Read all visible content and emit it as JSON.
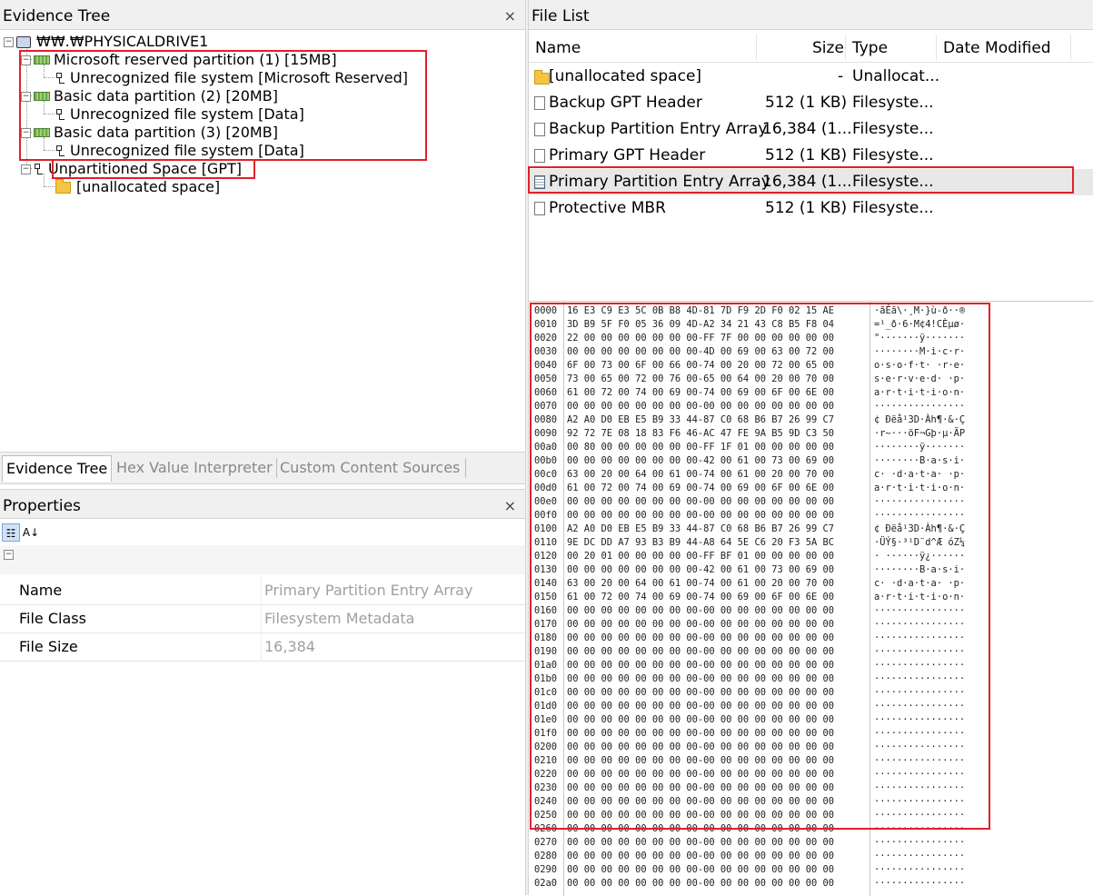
{
  "evidence_tree": {
    "title": "Evidence Tree",
    "close": "×",
    "nodes": {
      "root": "₩₩.₩PHYSICALDRIVE1",
      "p1": "Microsoft reserved partition (1) [15MB]",
      "p1fs": "Unrecognized file system [Microsoft Reserved]",
      "p2": "Basic data partition (2) [20MB]",
      "p2fs": "Unrecognized file system [Data]",
      "p3": "Basic data partition (3) [20MB]",
      "p3fs": "Unrecognized file system [Data]",
      "unpart": "Unpartitioned Space [GPT]",
      "unalloc": "[unallocated space]"
    }
  },
  "tabs": {
    "evidence_tree": "Evidence Tree",
    "hex_value_interpreter": "Hex Value Interpreter",
    "custom_content_sources": "Custom Content Sources"
  },
  "properties": {
    "title": "Properties",
    "close": "×",
    "group_toggle": "−",
    "rows": {
      "name": {
        "key": "Name",
        "value": "Primary Partition Entry Array"
      },
      "file_class": {
        "key": "File Class",
        "value": "Filesystem Metadata"
      },
      "file_size": {
        "key": "File Size",
        "value": "16,384"
      }
    }
  },
  "file_list": {
    "title": "File List",
    "columns": {
      "name": "Name",
      "size": "Size",
      "type": "Type",
      "date_modified": "Date Modified"
    },
    "rows": [
      {
        "name": "[unallocated space]",
        "size": "-",
        "type": "Unallocat...",
        "icon": "folder-icon"
      },
      {
        "name": "Backup GPT Header",
        "size": "512 (1 KB)",
        "type": "Filesyste...",
        "icon": "document-icon"
      },
      {
        "name": "Backup Partition Entry Array",
        "size": "16,384 (1...",
        "type": "Filesyste...",
        "icon": "document-icon"
      },
      {
        "name": "Primary GPT Header",
        "size": "512 (1 KB)",
        "type": "Filesyste...",
        "icon": "document-icon"
      },
      {
        "name": "Primary Partition Entry Array",
        "size": "16,384 (1...",
        "type": "Filesyste...",
        "icon": "document-icon"
      },
      {
        "name": "Protective MBR",
        "size": "512 (1 KB)",
        "type": "Filesyste...",
        "icon": "document-icon"
      }
    ]
  },
  "hex_view": {
    "rows": [
      {
        "offset": "0000",
        "bytes": "16 E3 C9 E3 5C 0B B8 4D-81 7D F9 2D F0 02 15 AE",
        "ascii": "·ãÉã\\·¸M·}ù-ð··®"
      },
      {
        "offset": "0010",
        "bytes": "3D B9 5F F0 05 36 09 4D-A2 34 21 43 C8 B5 F8 04",
        "ascii": "=¹_ð·6·M¢4!CÈµø·"
      },
      {
        "offset": "0020",
        "bytes": "22 00 00 00 00 00 00 00-FF 7F 00 00 00 00 00 00",
        "ascii": "\"·······ÿ·······"
      },
      {
        "offset": "0030",
        "bytes": "00 00 00 00 00 00 00 00-4D 00 69 00 63 00 72 00",
        "ascii": "········M·i·c·r·"
      },
      {
        "offset": "0040",
        "bytes": "6F 00 73 00 6F 00 66 00-74 00 20 00 72 00 65 00",
        "ascii": "o·s·o·f·t· ·r·e·"
      },
      {
        "offset": "0050",
        "bytes": "73 00 65 00 72 00 76 00-65 00 64 00 20 00 70 00",
        "ascii": "s·e·r·v·e·d· ·p·"
      },
      {
        "offset": "0060",
        "bytes": "61 00 72 00 74 00 69 00-74 00 69 00 6F 00 6E 00",
        "ascii": "a·r·t·i·t·i·o·n·"
      },
      {
        "offset": "0070",
        "bytes": "00 00 00 00 00 00 00 00-00 00 00 00 00 00 00 00",
        "ascii": "················"
      },
      {
        "offset": "0080",
        "bytes": "A2 A0 D0 EB E5 B9 33 44-87 C0 68 B6 B7 26 99 C7",
        "ascii": "¢ Ðëå¹3D·Àh¶·&·Ç"
      },
      {
        "offset": "0090",
        "bytes": "92 72 7E 08 18 83 F6 46-AC 47 FE 9A B5 9D C3 50",
        "ascii": "·r~···öF¬Gþ·µ·ÃP"
      },
      {
        "offset": "00a0",
        "bytes": "00 80 00 00 00 00 00 00-FF 1F 01 00 00 00 00 00",
        "ascii": "········ÿ·······"
      },
      {
        "offset": "00b0",
        "bytes": "00 00 00 00 00 00 00 00-42 00 61 00 73 00 69 00",
        "ascii": "········B·a·s·i·"
      },
      {
        "offset": "00c0",
        "bytes": "63 00 20 00 64 00 61 00-74 00 61 00 20 00 70 00",
        "ascii": "c· ·d·a·t·a· ·p·"
      },
      {
        "offset": "00d0",
        "bytes": "61 00 72 00 74 00 69 00-74 00 69 00 6F 00 6E 00",
        "ascii": "a·r·t·i·t·i·o·n·"
      },
      {
        "offset": "00e0",
        "bytes": "00 00 00 00 00 00 00 00-00 00 00 00 00 00 00 00",
        "ascii": "················"
      },
      {
        "offset": "00f0",
        "bytes": "00 00 00 00 00 00 00 00-00 00 00 00 00 00 00 00",
        "ascii": "················"
      },
      {
        "offset": "0100",
        "bytes": "A2 A0 D0 EB E5 B9 33 44-87 C0 68 B6 B7 26 99 C7",
        "ascii": "¢ Ðëå¹3D·Àh¶·&·Ç"
      },
      {
        "offset": "0110",
        "bytes": "9E DC DD A7 93 B3 B9 44-A8 64 5E C6 20 F3 5A BC",
        "ascii": "·ÜÝ§·³¹D¨d^Æ óZ¼"
      },
      {
        "offset": "0120",
        "bytes": "00 20 01 00 00 00 00 00-FF BF 01 00 00 00 00 00",
        "ascii": "· ······ÿ¿······"
      },
      {
        "offset": "0130",
        "bytes": "00 00 00 00 00 00 00 00-42 00 61 00 73 00 69 00",
        "ascii": "········B·a·s·i·"
      },
      {
        "offset": "0140",
        "bytes": "63 00 20 00 64 00 61 00-74 00 61 00 20 00 70 00",
        "ascii": "c· ·d·a·t·a· ·p·"
      },
      {
        "offset": "0150",
        "bytes": "61 00 72 00 74 00 69 00-74 00 69 00 6F 00 6E 00",
        "ascii": "a·r·t·i·t·i·o·n·"
      },
      {
        "offset": "0160",
        "bytes": "00 00 00 00 00 00 00 00-00 00 00 00 00 00 00 00",
        "ascii": "················"
      },
      {
        "offset": "0170",
        "bytes": "00 00 00 00 00 00 00 00-00 00 00 00 00 00 00 00",
        "ascii": "················"
      },
      {
        "offset": "0180",
        "bytes": "00 00 00 00 00 00 00 00-00 00 00 00 00 00 00 00",
        "ascii": "················"
      },
      {
        "offset": "0190",
        "bytes": "00 00 00 00 00 00 00 00-00 00 00 00 00 00 00 00",
        "ascii": "················"
      },
      {
        "offset": "01a0",
        "bytes": "00 00 00 00 00 00 00 00-00 00 00 00 00 00 00 00",
        "ascii": "················"
      },
      {
        "offset": "01b0",
        "bytes": "00 00 00 00 00 00 00 00-00 00 00 00 00 00 00 00",
        "ascii": "················"
      },
      {
        "offset": "01c0",
        "bytes": "00 00 00 00 00 00 00 00-00 00 00 00 00 00 00 00",
        "ascii": "················"
      },
      {
        "offset": "01d0",
        "bytes": "00 00 00 00 00 00 00 00-00 00 00 00 00 00 00 00",
        "ascii": "················"
      },
      {
        "offset": "01e0",
        "bytes": "00 00 00 00 00 00 00 00-00 00 00 00 00 00 00 00",
        "ascii": "················"
      },
      {
        "offset": "01f0",
        "bytes": "00 00 00 00 00 00 00 00-00 00 00 00 00 00 00 00",
        "ascii": "················"
      },
      {
        "offset": "0200",
        "bytes": "00 00 00 00 00 00 00 00-00 00 00 00 00 00 00 00",
        "ascii": "················"
      },
      {
        "offset": "0210",
        "bytes": "00 00 00 00 00 00 00 00-00 00 00 00 00 00 00 00",
        "ascii": "················"
      },
      {
        "offset": "0220",
        "bytes": "00 00 00 00 00 00 00 00-00 00 00 00 00 00 00 00",
        "ascii": "················"
      },
      {
        "offset": "0230",
        "bytes": "00 00 00 00 00 00 00 00-00 00 00 00 00 00 00 00",
        "ascii": "················"
      },
      {
        "offset": "0240",
        "bytes": "00 00 00 00 00 00 00 00-00 00 00 00 00 00 00 00",
        "ascii": "················"
      },
      {
        "offset": "0250",
        "bytes": "00 00 00 00 00 00 00 00-00 00 00 00 00 00 00 00",
        "ascii": "················"
      },
      {
        "offset": "0260",
        "bytes": "00 00 00 00 00 00 00 00-00 00 00 00 00 00 00 00",
        "ascii": "················"
      },
      {
        "offset": "0270",
        "bytes": "00 00 00 00 00 00 00 00-00 00 00 00 00 00 00 00",
        "ascii": "················"
      },
      {
        "offset": "0280",
        "bytes": "00 00 00 00 00 00 00 00-00 00 00 00 00 00 00 00",
        "ascii": "················"
      },
      {
        "offset": "0290",
        "bytes": "00 00 00 00 00 00 00 00-00 00 00 00 00 00 00 00",
        "ascii": "················"
      },
      {
        "offset": "02a0",
        "bytes": "00 00 00 00 00 00 00 00-00 00 00 00 00 00 00 00",
        "ascii": "················"
      }
    ]
  }
}
